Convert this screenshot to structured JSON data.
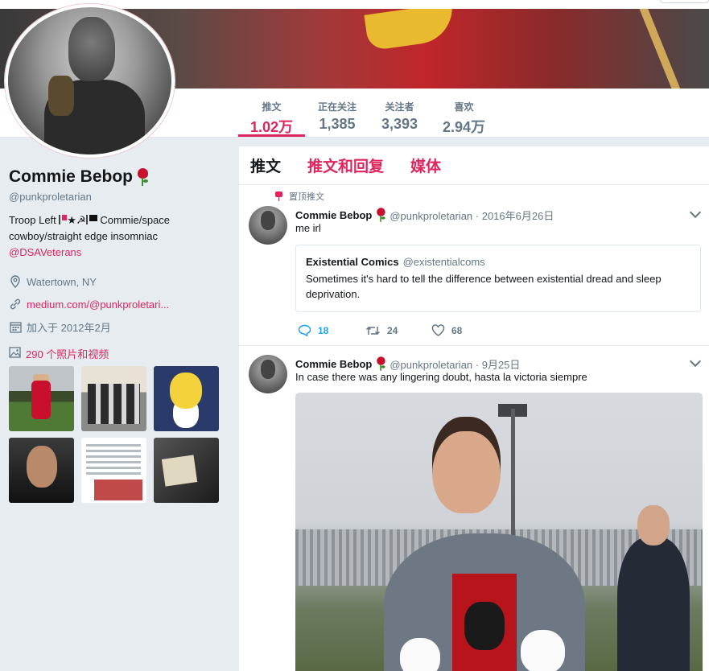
{
  "nav": {
    "items": [
      {
        "label": "推文",
        "value": "1.02万"
      },
      {
        "label": "正在关注",
        "value": "1,385"
      },
      {
        "label": "关注者",
        "value": "3,393"
      },
      {
        "label": "喜欢",
        "value": "2.94万"
      }
    ]
  },
  "profile": {
    "name": "Commie Bebop",
    "handle": "@punkproletarian",
    "bio_start": "Troop Left",
    "bio_rest": "Commie/space cowboy/straight edge insomniac",
    "bio_glyphs": "★☭",
    "bio_link": "@DSAVeterans",
    "location": "Watertown, NY",
    "website": "medium.com/@punkproletari...",
    "joined": "加入于 2012年2月",
    "photos_label": "290 个照片和视频"
  },
  "tabs": [
    "推文",
    "推文和回复",
    "媒体"
  ],
  "tweets": [
    {
      "pinned_label": "置顶推文",
      "name": "Commie Bebop",
      "meta": "@punkproletarian · 2016年6月26日",
      "text": "me irl",
      "quote": {
        "name": "Existential Comics",
        "handle": "@existentialcoms",
        "text": "Sometimes it's hard to tell the difference between existential dread and sleep deprivation."
      },
      "replies": "18",
      "retweets": "24",
      "likes": "68"
    },
    {
      "name": "Commie Bebop",
      "meta": "@punkproletarian · 9月25日",
      "text": "In case there was any lingering doubt, hasta la victoria siempre"
    }
  ],
  "colors": {
    "accent": "#e0245e",
    "reply_blue": "#1da1f2",
    "muted": "#657786",
    "background": "#e6ecf0"
  },
  "icons": [
    "location-pin-icon",
    "link-icon",
    "calendar-icon",
    "image-icon",
    "pin-icon",
    "reply-icon",
    "retweet-icon",
    "heart-icon",
    "chevron-down-icon",
    "rose-icon"
  ]
}
